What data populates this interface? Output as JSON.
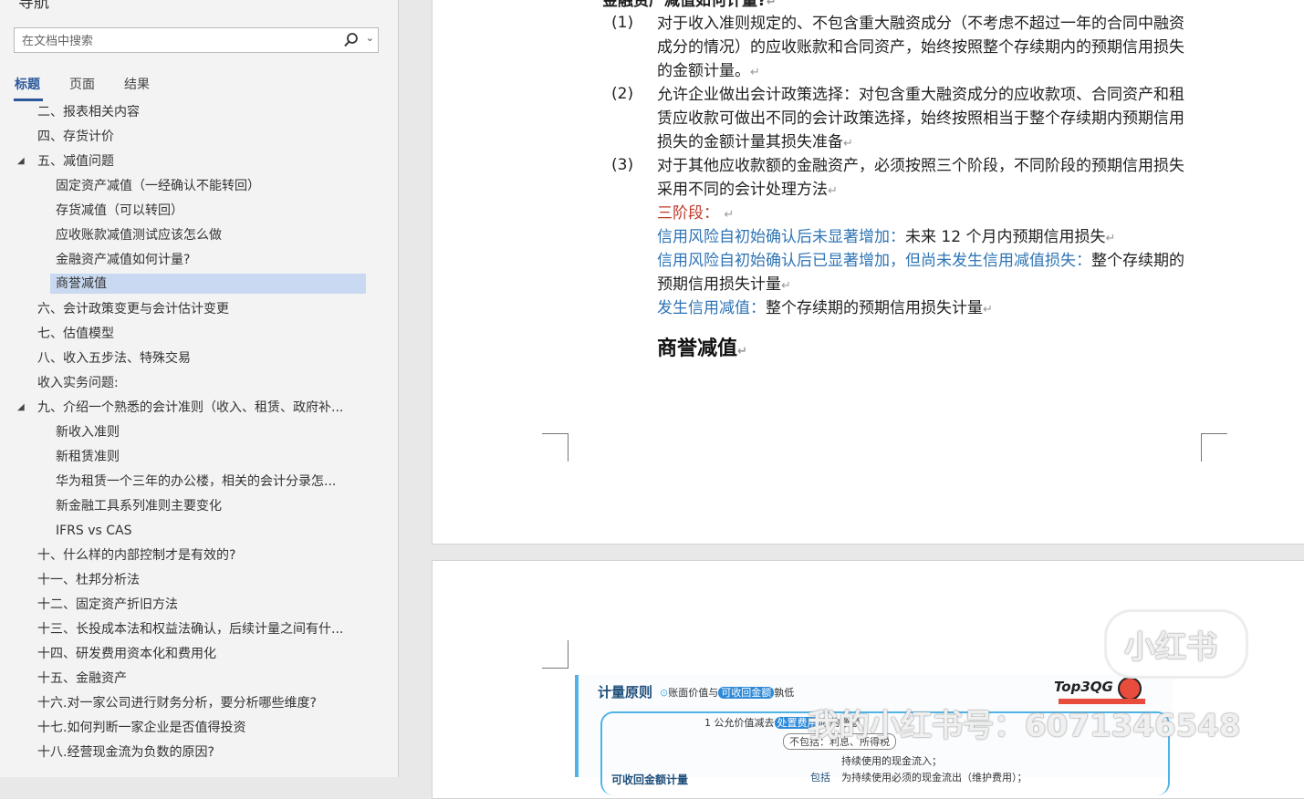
{
  "nav": {
    "title": "导航",
    "search_placeholder": "在文档中搜索",
    "tabs": [
      {
        "label": "标题"
      },
      {
        "label": "页面"
      },
      {
        "label": "结果"
      }
    ],
    "outline": [
      {
        "text": "二、报表相关内容"
      },
      {
        "text": "四、存货计价"
      },
      {
        "text": "五、减值问题"
      },
      {
        "text": "固定资产减值（一经确认不能转回）"
      },
      {
        "text": "存货减值（可以转回）"
      },
      {
        "text": "应收账款减值测试应该怎么做"
      },
      {
        "text": "金融资产减值如何计量?"
      },
      {
        "text": "商誉减值"
      },
      {
        "text": "六、会计政策变更与会计估计变更"
      },
      {
        "text": "七、估值模型"
      },
      {
        "text": "八、收入五步法、特殊交易"
      },
      {
        "text": "收入实务问题:"
      },
      {
        "text": "九、介绍一个熟悉的会计准则（收入、租赁、政府补..."
      },
      {
        "text": "新收入准则"
      },
      {
        "text": "新租赁准则"
      },
      {
        "text": "华为租赁一个三年的办公楼，相关的会计分录怎..."
      },
      {
        "text": "新金融工具系列准则主要变化"
      },
      {
        "text": "IFRS vs CAS"
      },
      {
        "text": "十、什么样的内部控制才是有效的?"
      },
      {
        "text": "十一、杜邦分析法"
      },
      {
        "text": "十二、固定资产折旧方法"
      },
      {
        "text": "十三、长投成本法和权益法确认，后续计量之间有什..."
      },
      {
        "text": "十四、研发费用资本化和费用化"
      },
      {
        "text": "十五、金融资产"
      },
      {
        "text": "十六.对一家公司进行财务分析，要分析哪些维度?"
      },
      {
        "text": "十七.如何判断一家企业是否值得投资"
      },
      {
        "text": "十八.经营现金流为负数的原因?"
      }
    ]
  },
  "doc": {
    "top_heading": "金融资产减值如何计量?",
    "items": [
      {
        "num": "(1)",
        "lines": [
          "对于收入准则规定的、不包含重大融资成分（不考虑不超过一年的合同中融资",
          "成分的情况）的应收账款和合同资产，始终按照整个存续期内的预期信用损失",
          "的金额计量。"
        ]
      },
      {
        "num": "(2)",
        "lines": [
          "允许企业做出会计政策选择：对包含重大融资成分的应收款项、合同资产和租",
          "赁应收款可做出不同的会计政策选择，始终按照相当于整个存续期内预期信用",
          "损失的金额计量其损失准备"
        ]
      },
      {
        "num": "(3)",
        "lines": [
          "对于其他应收款额的金融资产，必须按照三个阶段，不同阶段的预期信用损失",
          "采用不同的会计处理方法"
        ]
      }
    ],
    "stages_label": "三阶段：",
    "stage1_label": "信用风险自初始确认后未显著增加：",
    "stage1_text": "未来 12 个月内预期信用损失",
    "stage2_label": "信用风险自初始确认后已显著增加，但尚未发生信用减值损失：",
    "stage2_text_a": "整个存续期的",
    "stage2_text_b": "预期信用损失计量",
    "stage3_label": "发生信用减值：",
    "stage3_text": "整个存续期的预期信用损失计量",
    "goodwill_heading": "商誉减值",
    "para_mark": "↵"
  },
  "mindmap": {
    "title": "计量原则",
    "subtitle_a": "账面价值与",
    "subtitle_badge": "可收回金额",
    "subtitle_b": "孰低",
    "node1_a": "1 公允价值减去",
    "node1_badge": "处置费用",
    "node1_b": "后的净额",
    "node2": "不包括：利息、所得税",
    "node3": "持续使用的现金流入；",
    "node4": "为持续使用必须的现金流出（维护费用）；",
    "left_label": "可收回金额计量",
    "left_label2": "包括",
    "brand": "小红书",
    "sticker": "Top3QG",
    "watermark": "我的小红书号：607134654​8"
  }
}
